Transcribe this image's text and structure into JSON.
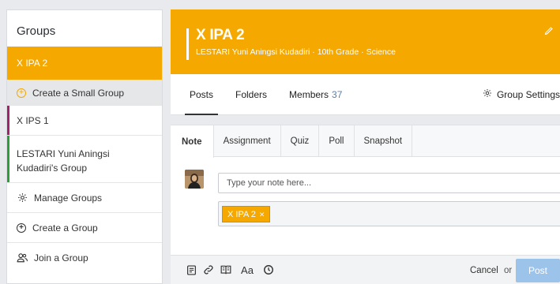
{
  "sidebar": {
    "title": "Groups",
    "active_group": "X IPA 2",
    "create_small_group": "Create a Small Group",
    "groups": [
      {
        "label": "X IPS 1",
        "color": "#a0246a"
      },
      {
        "label": "LESTARI Yuni Aningsi Kudadiri's Group",
        "color": "#2e9d3a"
      }
    ],
    "manage_groups": "Manage Groups",
    "create_group": "Create a Group",
    "join_group": "Join a Group"
  },
  "header": {
    "title": "X IPA 2",
    "subtitle": "LESTARI Yuni Aningsi Kudadiri · 10th Grade · Science",
    "color": "#f5a800"
  },
  "tabs": {
    "posts": "Posts",
    "folders": "Folders",
    "members": "Members",
    "members_count": "37",
    "settings": "Group Settings"
  },
  "composer": {
    "tabs": [
      "Note",
      "Assignment",
      "Quiz",
      "Poll",
      "Snapshot"
    ],
    "active_tab": "Note",
    "note_placeholder": "Type your note here...",
    "recipient_chip": "X IPA 2",
    "cancel": "Cancel",
    "or": "or",
    "post": "Post",
    "toolbar_icons": [
      "file-icon",
      "link-icon",
      "library-icon",
      "text-format-icon",
      "clock-icon"
    ]
  }
}
